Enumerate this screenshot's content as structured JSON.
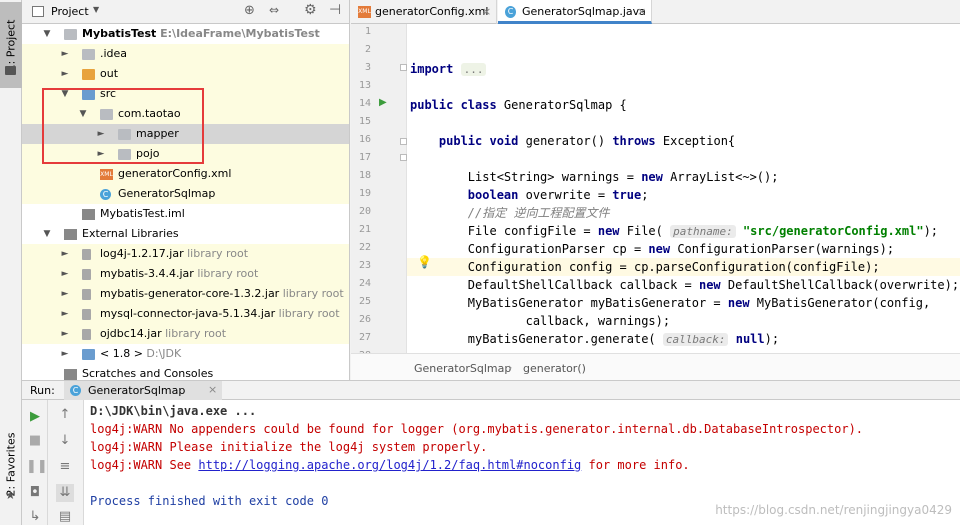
{
  "left_strip": {
    "project_tab": "1: Project",
    "favorites_tab": "2: Favorites"
  },
  "project_panel": {
    "title": "Project",
    "tree": [
      {
        "label": "MybatisTest",
        "secondary": "E:\\IdeaFrame\\MybatisTest",
        "indent": 0,
        "icon": "module-folder-icon",
        "arrow": "down"
      },
      {
        "label": ".idea",
        "secondary": "",
        "indent": 1,
        "icon": "folder-icon",
        "arrow": "right"
      },
      {
        "label": "out",
        "secondary": "",
        "indent": 1,
        "icon": "folder-orange-icon",
        "arrow": "right"
      },
      {
        "label": "src",
        "secondary": "",
        "indent": 1,
        "icon": "source-folder-icon",
        "arrow": "down"
      },
      {
        "label": "com.taotao",
        "secondary": "",
        "indent": 2,
        "icon": "package-icon",
        "arrow": "down"
      },
      {
        "label": "mapper",
        "secondary": "",
        "indent": 3,
        "icon": "package-icon",
        "arrow": "right"
      },
      {
        "label": "pojo",
        "secondary": "",
        "indent": 3,
        "icon": "package-icon",
        "arrow": "right"
      },
      {
        "label": "generatorConfig.xml",
        "secondary": "",
        "indent": 2,
        "icon": "xml-file-icon",
        "arrow": ""
      },
      {
        "label": "GeneratorSqlmap",
        "secondary": "",
        "indent": 2,
        "icon": "java-class-icon",
        "arrow": ""
      },
      {
        "label": "MybatisTest.iml",
        "secondary": "",
        "indent": 1,
        "icon": "iml-file-icon",
        "arrow": ""
      },
      {
        "label": "External Libraries",
        "secondary": "",
        "indent": 0,
        "icon": "libraries-icon",
        "arrow": "down"
      },
      {
        "label": "log4j-1.2.17.jar",
        "secondary": "library root",
        "indent": 1,
        "icon": "jar-icon",
        "arrow": "right"
      },
      {
        "label": "mybatis-3.4.4.jar",
        "secondary": "library root",
        "indent": 1,
        "icon": "jar-icon",
        "arrow": "right"
      },
      {
        "label": "mybatis-generator-core-1.3.2.jar",
        "secondary": "library root",
        "indent": 1,
        "icon": "jar-icon",
        "arrow": "right"
      },
      {
        "label": "mysql-connector-java-5.1.34.jar",
        "secondary": "library root",
        "indent": 1,
        "icon": "jar-icon",
        "arrow": "right"
      },
      {
        "label": "ojdbc14.jar",
        "secondary": "library root",
        "indent": 1,
        "icon": "jar-icon",
        "arrow": "right"
      },
      {
        "label": "< 1.8 >",
        "secondary": "D:\\JDK",
        "indent": 1,
        "icon": "jdk-icon",
        "arrow": "right"
      },
      {
        "label": "Scratches and Consoles",
        "secondary": "",
        "indent": 0,
        "icon": "scratches-icon",
        "arrow": ""
      }
    ]
  },
  "editor_tabs": [
    {
      "label": "generatorConfig.xml",
      "icon": "xml-file-icon",
      "active": false
    },
    {
      "label": "GeneratorSqlmap.java",
      "icon": "java-class-icon",
      "active": true
    }
  ],
  "editor": {
    "lines": [
      {
        "num": "1",
        "html": ""
      },
      {
        "num": "2",
        "html": ""
      },
      {
        "num": "3",
        "html": "<span class='kw'>import</span> <span class='hint' style='font-style:normal;background:#eef3e6'>...</span>"
      },
      {
        "num": "13",
        "html": ""
      },
      {
        "num": "14",
        "html": "<span class='kw'>public class</span> GeneratorSqlmap {"
      },
      {
        "num": "15",
        "html": ""
      },
      {
        "num": "16",
        "html": "    <span class='kw'>public void</span> generator() <span class='kw'>throws</span> Exception{"
      },
      {
        "num": "17",
        "html": ""
      },
      {
        "num": "18",
        "html": "        List&lt;String&gt; warnings = <span class='kw'>new</span> ArrayList&lt;~&gt;();"
      },
      {
        "num": "19",
        "html": "        <span class='kw'>boolean</span> overwrite = <span class='kw'>true</span>;"
      },
      {
        "num": "20",
        "html": "        <span class='cmt'>//指定 逆向工程配置文件</span>"
      },
      {
        "num": "21",
        "html": "        File configFile = <span class='kw'>new</span> File( <span class='hint'>pathname:</span> <span class='str'>\"src/generatorConfig.xml\"</span>);"
      },
      {
        "num": "22",
        "html": "        ConfigurationParser cp = <span class='kw'>new</span> ConfigurationParser(warnings);"
      },
      {
        "num": "23",
        "html": "        Configuration config = cp.parseConfiguration(configFile);"
      },
      {
        "num": "24",
        "html": "        DefaultShellCallback callback = <span class='kw'>new</span> DefaultShellCallback(overwrite);"
      },
      {
        "num": "25",
        "html": "        MyBatisGenerator myBatisGenerator = <span class='kw'>new</span> MyBatisGenerator(config,"
      },
      {
        "num": "26",
        "html": "                callback, warnings);"
      },
      {
        "num": "27",
        "html": "        myBatisGenerator.generate( <span class='hint'>callback:</span> <span class='kw'>null</span>);"
      },
      {
        "num": "28",
        "html": ""
      }
    ],
    "breadcrumbs": [
      "GeneratorSqlmap",
      "generator()"
    ]
  },
  "run_panel": {
    "label": "Run:",
    "tab": "GeneratorSqlmap",
    "console": [
      {
        "text": "D:\\JDK\\bin\\java.exe ...",
        "style": "bold"
      },
      {
        "text": "log4j:WARN No appenders could be found for logger (org.mybatis.generator.internal.db.DatabaseIntrospector).",
        "style": "red"
      },
      {
        "text": "log4j:WARN Please initialize the log4j system properly.",
        "style": "red"
      },
      {
        "text": "log4j:WARN See ",
        "link": "http://logging.apache.org/log4j/1.2/faq.html#noconfig",
        "after": " for more info.",
        "style": "red"
      },
      {
        "text": "",
        "style": ""
      },
      {
        "text": "Process finished with exit code 0",
        "style": "blue"
      }
    ]
  },
  "watermark": "https://blog.csdn.net/renjingjingya0429"
}
